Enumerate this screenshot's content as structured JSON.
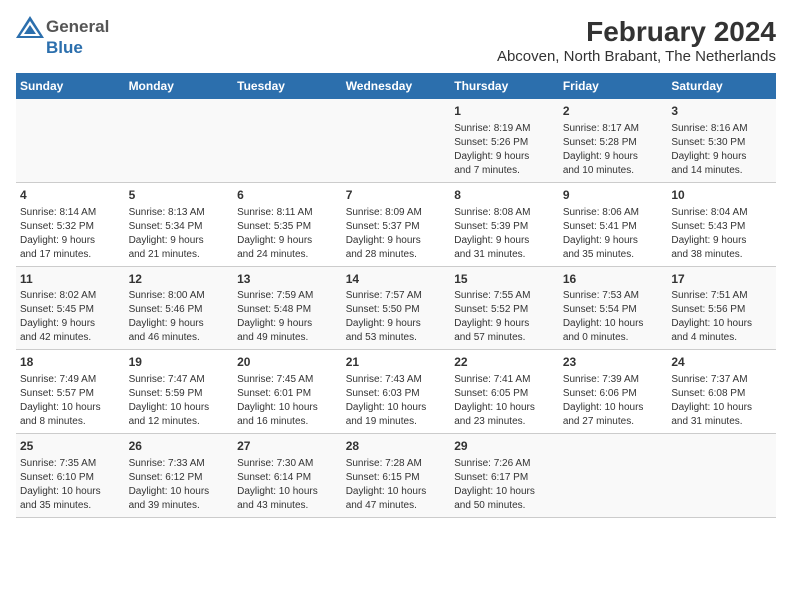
{
  "logo": {
    "general": "General",
    "blue": "Blue"
  },
  "title": "February 2024",
  "subtitle": "Abcoven, North Brabant, The Netherlands",
  "weekdays": [
    "Sunday",
    "Monday",
    "Tuesday",
    "Wednesday",
    "Thursday",
    "Friday",
    "Saturday"
  ],
  "weeks": [
    [
      {
        "day": "",
        "info": ""
      },
      {
        "day": "",
        "info": ""
      },
      {
        "day": "",
        "info": ""
      },
      {
        "day": "",
        "info": ""
      },
      {
        "day": "1",
        "info": "Sunrise: 8:19 AM\nSunset: 5:26 PM\nDaylight: 9 hours\nand 7 minutes."
      },
      {
        "day": "2",
        "info": "Sunrise: 8:17 AM\nSunset: 5:28 PM\nDaylight: 9 hours\nand 10 minutes."
      },
      {
        "day": "3",
        "info": "Sunrise: 8:16 AM\nSunset: 5:30 PM\nDaylight: 9 hours\nand 14 minutes."
      }
    ],
    [
      {
        "day": "4",
        "info": "Sunrise: 8:14 AM\nSunset: 5:32 PM\nDaylight: 9 hours\nand 17 minutes."
      },
      {
        "day": "5",
        "info": "Sunrise: 8:13 AM\nSunset: 5:34 PM\nDaylight: 9 hours\nand 21 minutes."
      },
      {
        "day": "6",
        "info": "Sunrise: 8:11 AM\nSunset: 5:35 PM\nDaylight: 9 hours\nand 24 minutes."
      },
      {
        "day": "7",
        "info": "Sunrise: 8:09 AM\nSunset: 5:37 PM\nDaylight: 9 hours\nand 28 minutes."
      },
      {
        "day": "8",
        "info": "Sunrise: 8:08 AM\nSunset: 5:39 PM\nDaylight: 9 hours\nand 31 minutes."
      },
      {
        "day": "9",
        "info": "Sunrise: 8:06 AM\nSunset: 5:41 PM\nDaylight: 9 hours\nand 35 minutes."
      },
      {
        "day": "10",
        "info": "Sunrise: 8:04 AM\nSunset: 5:43 PM\nDaylight: 9 hours\nand 38 minutes."
      }
    ],
    [
      {
        "day": "11",
        "info": "Sunrise: 8:02 AM\nSunset: 5:45 PM\nDaylight: 9 hours\nand 42 minutes."
      },
      {
        "day": "12",
        "info": "Sunrise: 8:00 AM\nSunset: 5:46 PM\nDaylight: 9 hours\nand 46 minutes."
      },
      {
        "day": "13",
        "info": "Sunrise: 7:59 AM\nSunset: 5:48 PM\nDaylight: 9 hours\nand 49 minutes."
      },
      {
        "day": "14",
        "info": "Sunrise: 7:57 AM\nSunset: 5:50 PM\nDaylight: 9 hours\nand 53 minutes."
      },
      {
        "day": "15",
        "info": "Sunrise: 7:55 AM\nSunset: 5:52 PM\nDaylight: 9 hours\nand 57 minutes."
      },
      {
        "day": "16",
        "info": "Sunrise: 7:53 AM\nSunset: 5:54 PM\nDaylight: 10 hours\nand 0 minutes."
      },
      {
        "day": "17",
        "info": "Sunrise: 7:51 AM\nSunset: 5:56 PM\nDaylight: 10 hours\nand 4 minutes."
      }
    ],
    [
      {
        "day": "18",
        "info": "Sunrise: 7:49 AM\nSunset: 5:57 PM\nDaylight: 10 hours\nand 8 minutes."
      },
      {
        "day": "19",
        "info": "Sunrise: 7:47 AM\nSunset: 5:59 PM\nDaylight: 10 hours\nand 12 minutes."
      },
      {
        "day": "20",
        "info": "Sunrise: 7:45 AM\nSunset: 6:01 PM\nDaylight: 10 hours\nand 16 minutes."
      },
      {
        "day": "21",
        "info": "Sunrise: 7:43 AM\nSunset: 6:03 PM\nDaylight: 10 hours\nand 19 minutes."
      },
      {
        "day": "22",
        "info": "Sunrise: 7:41 AM\nSunset: 6:05 PM\nDaylight: 10 hours\nand 23 minutes."
      },
      {
        "day": "23",
        "info": "Sunrise: 7:39 AM\nSunset: 6:06 PM\nDaylight: 10 hours\nand 27 minutes."
      },
      {
        "day": "24",
        "info": "Sunrise: 7:37 AM\nSunset: 6:08 PM\nDaylight: 10 hours\nand 31 minutes."
      }
    ],
    [
      {
        "day": "25",
        "info": "Sunrise: 7:35 AM\nSunset: 6:10 PM\nDaylight: 10 hours\nand 35 minutes."
      },
      {
        "day": "26",
        "info": "Sunrise: 7:33 AM\nSunset: 6:12 PM\nDaylight: 10 hours\nand 39 minutes."
      },
      {
        "day": "27",
        "info": "Sunrise: 7:30 AM\nSunset: 6:14 PM\nDaylight: 10 hours\nand 43 minutes."
      },
      {
        "day": "28",
        "info": "Sunrise: 7:28 AM\nSunset: 6:15 PM\nDaylight: 10 hours\nand 47 minutes."
      },
      {
        "day": "29",
        "info": "Sunrise: 7:26 AM\nSunset: 6:17 PM\nDaylight: 10 hours\nand 50 minutes."
      },
      {
        "day": "",
        "info": ""
      },
      {
        "day": "",
        "info": ""
      }
    ]
  ]
}
